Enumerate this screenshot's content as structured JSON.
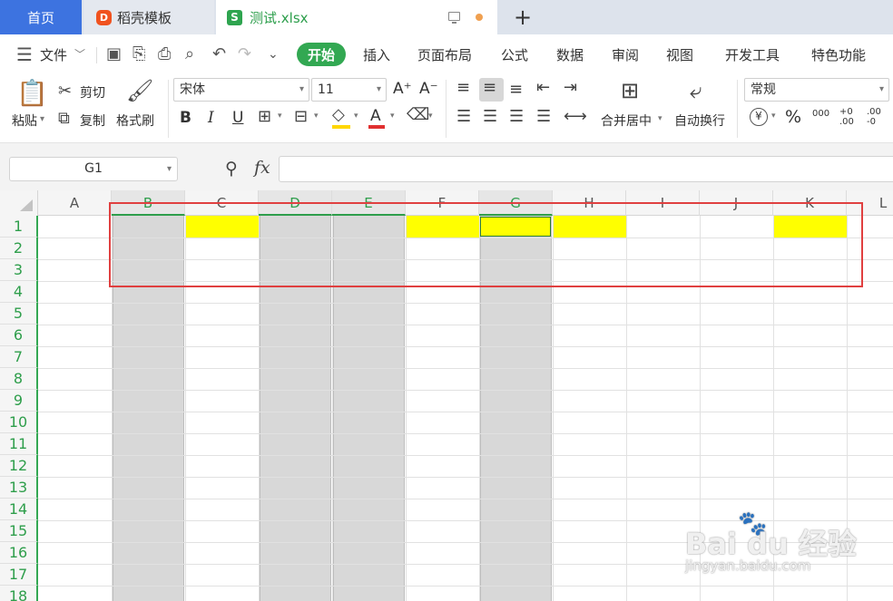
{
  "tabs": {
    "home": "首页",
    "template": "稻壳模板",
    "file": "测试.xlsx",
    "new_tab": "+"
  },
  "menu": {
    "file": "文件",
    "items": [
      "开始",
      "插入",
      "页面布局",
      "公式",
      "数据",
      "审阅",
      "视图",
      "开发工具",
      "特色功能"
    ]
  },
  "ribbon": {
    "paste": "粘贴",
    "cut": "剪切",
    "copy": "复制",
    "format_painter": "格式刷",
    "font_name": "宋体",
    "font_size": "11",
    "bold": "B",
    "italic": "I",
    "underline": "U",
    "font_color": "A",
    "grow_font": "A⁺",
    "shrink_font": "A⁻",
    "merge_center": "合并居中",
    "wrap_text": "自动换行",
    "number_format": "常规",
    "currency": "¥",
    "percent": "%",
    "thousands": "000",
    "inc_decimal": "+0 .00",
    "dec_decimal": ".00 -0"
  },
  "formula_bar": {
    "name_box": "G1",
    "fx": "fx",
    "value": ""
  },
  "grid": {
    "columns": [
      "A",
      "B",
      "C",
      "D",
      "E",
      "F",
      "G",
      "H",
      "I",
      "J",
      "K",
      "L"
    ],
    "rows": [
      "1",
      "2",
      "3",
      "4",
      "5",
      "6",
      "7",
      "8",
      "9",
      "10",
      "11",
      "12",
      "13",
      "14",
      "15",
      "16",
      "17",
      "18"
    ],
    "selected_columns": [
      "B",
      "D",
      "E",
      "G"
    ],
    "yellow_cells": [
      "C1",
      "F1",
      "H1",
      "K1"
    ],
    "active_cell": "G1"
  },
  "watermark": {
    "main": "Bai du 经验",
    "sub": "jingyan.baidu.com"
  },
  "colors": {
    "accent_green": "#32a852",
    "home_tab": "#3d73e0",
    "highlight_yellow": "#ffff00",
    "annotation_red": "#e04040",
    "selected_column_gray": "#d8d8d8"
  }
}
